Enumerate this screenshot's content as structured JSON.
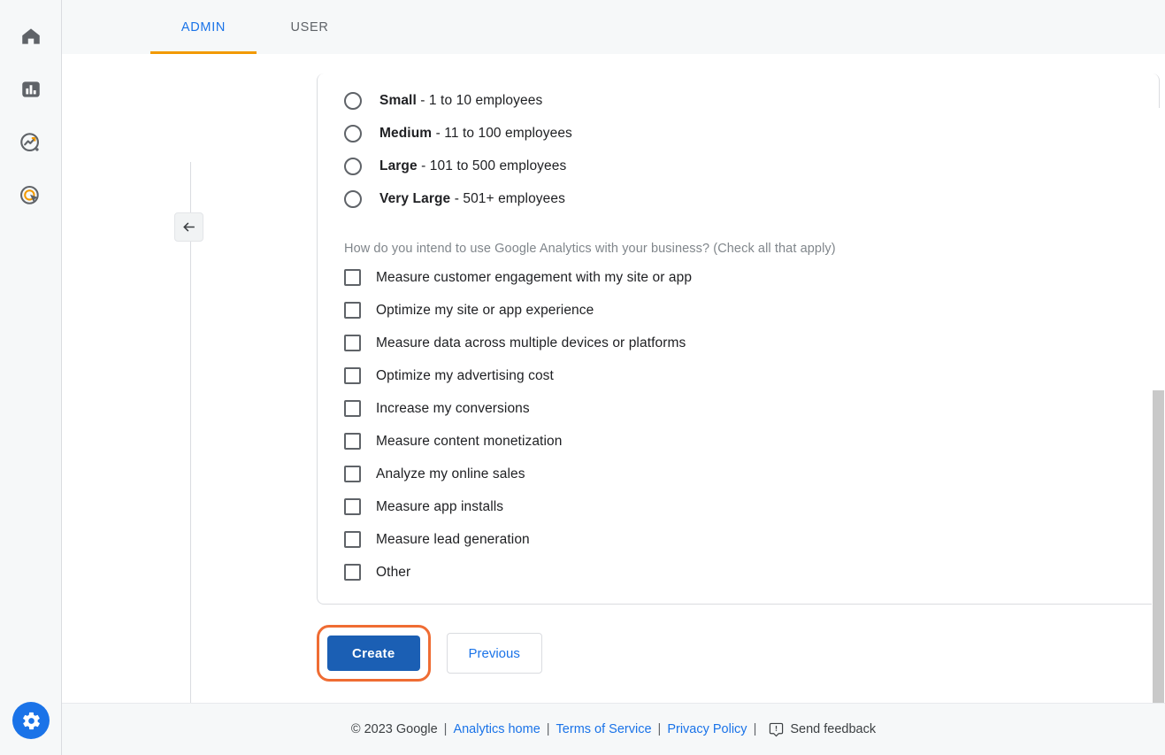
{
  "rail": {
    "items": [
      {
        "name": "home",
        "icon": "home-icon",
        "label": "Home"
      },
      {
        "name": "reports",
        "icon": "bar-chart-icon",
        "label": "Reports"
      },
      {
        "name": "explore",
        "icon": "explore-trend-icon",
        "label": "Explore"
      },
      {
        "name": "advertising",
        "icon": "advertising-target-icon",
        "label": "Advertising"
      }
    ],
    "bottom": {
      "name": "admin",
      "icon": "gear-icon",
      "label": "Admin",
      "color": "#1a73e8"
    }
  },
  "tabs": [
    {
      "id": "admin",
      "label": "ADMIN",
      "active": true
    },
    {
      "id": "user",
      "label": "USER",
      "active": false
    }
  ],
  "accent": {
    "tab_underline": "#f29900",
    "tab_active_text": "#1a73e8",
    "highlight_ring": "#ef6c33",
    "primary_button": "#1b5fb4"
  },
  "back_button": {
    "icon": "arrow-left-icon",
    "label": "Collapse"
  },
  "form": {
    "business_size": {
      "options": [
        {
          "bold": "Small",
          "rest": " - 1 to 10 employees",
          "selected": false
        },
        {
          "bold": "Medium",
          "rest": " - 11 to 100 employees",
          "selected": false
        },
        {
          "bold": "Large",
          "rest": " - 101 to 500 employees",
          "selected": false
        },
        {
          "bold": "Very Large",
          "rest": " - 501+ employees",
          "selected": false
        }
      ]
    },
    "intent_question": "How do you intend to use Google Analytics with your business? (Check all that apply)",
    "intent_options": [
      {
        "label": "Measure customer engagement with my site or app",
        "checked": false
      },
      {
        "label": "Optimize my site or app experience",
        "checked": false
      },
      {
        "label": "Measure data across multiple devices or platforms",
        "checked": false
      },
      {
        "label": "Optimize my advertising cost",
        "checked": false
      },
      {
        "label": "Increase my conversions",
        "checked": false
      },
      {
        "label": "Measure content monetization",
        "checked": false
      },
      {
        "label": "Analyze my online sales",
        "checked": false
      },
      {
        "label": "Measure app installs",
        "checked": false
      },
      {
        "label": "Measure lead generation",
        "checked": false
      },
      {
        "label": "Other",
        "checked": false
      }
    ]
  },
  "actions": {
    "create_label": "Create",
    "previous_label": "Previous"
  },
  "footer": {
    "copyright": "© 2023 Google",
    "sep": "|",
    "links": [
      {
        "id": "analytics-home",
        "label": "Analytics home"
      },
      {
        "id": "terms-of-service",
        "label": "Terms of Service"
      },
      {
        "id": "privacy-policy",
        "label": "Privacy Policy"
      }
    ],
    "feedback_label": "Send feedback",
    "feedback_icon": "feedback-icon"
  }
}
